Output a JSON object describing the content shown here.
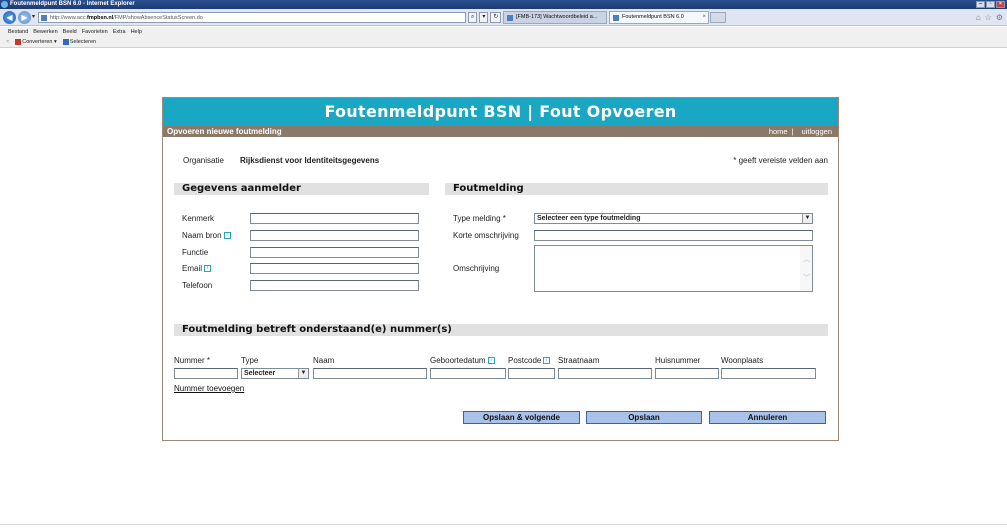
{
  "window": {
    "title": "Foutenmeldpunt BSN 6.0 - Internet Explorer"
  },
  "browser": {
    "address": {
      "prefix": "http://www.acc.",
      "domain": "fmpbsn.nl",
      "path": "/FMP/showAbsenceStatusScreen.do"
    },
    "addr_search_glyph": "⌕",
    "addr_dropdown_glyph": "▾",
    "addr_refresh_glyph": "↻",
    "tabs": [
      {
        "label": "[FMB-173] Wachtwoordbeleid a..."
      },
      {
        "label": "Foutenmeldpunt BSN 6.0"
      }
    ],
    "tab_close": "×",
    "menu": [
      "Bestand",
      "Bewerken",
      "Beeld",
      "Favorieten",
      "Extra",
      "Help"
    ],
    "cmd": {
      "close": "×",
      "convert": "Converteren",
      "convert_arrow": "▾",
      "select": "Selecteren"
    },
    "right_icons": [
      "⌂",
      "☆",
      "⚙"
    ]
  },
  "header": {
    "banner": "Foutenmeldpunt BSN | Fout Opvoeren",
    "subtitle": "Opvoeren nieuwe foutmelding",
    "home": "home",
    "separator": "|",
    "logout": "uitloggen"
  },
  "org": {
    "label": "Organisatie",
    "value": "Rijksdienst voor Identiteitsgegevens",
    "required_note": "* geeft vereiste velden aan"
  },
  "aanmelder": {
    "heading": "Gegevens aanmelder",
    "fields": [
      "Kenmerk",
      "Naam bron",
      "Functie",
      "Email",
      "Telefoon"
    ],
    "info_glyph": "i"
  },
  "melding": {
    "heading": "Foutmelding",
    "type_label": "Type melding *",
    "type_value": "Selecteer een type foutmelding",
    "korte_label": "Korte omschrijving",
    "omschrijving_label": "Omschrijving"
  },
  "nummers": {
    "heading": "Foutmelding betreft onderstaand(e) nummer(s)",
    "columns": [
      "Nummer *",
      "Type",
      "Naam",
      "Geboortedatum",
      "Postcode",
      "Straatnaam",
      "Huisnummer",
      "Woonplaats"
    ],
    "type_select": "Selecteer",
    "add_link": "Nummer toevoegen"
  },
  "actions": {
    "save_next": "Opslaan & volgende",
    "save": "Opslaan",
    "cancel": "Annuleren"
  },
  "colors": {
    "banner": "#19a7c3",
    "subbar": "#8a7868",
    "button": "#a9c2ea",
    "section": "#e1e1e1"
  }
}
